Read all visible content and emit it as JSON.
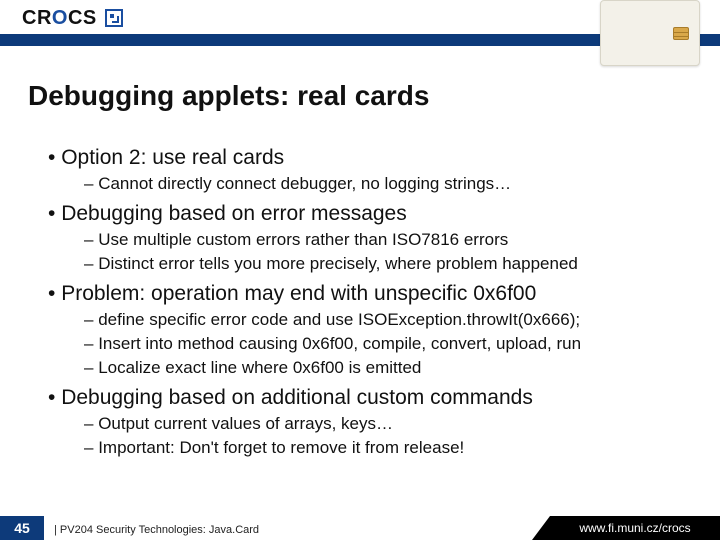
{
  "logo": {
    "text_pre": "CR",
    "text_o": "O",
    "text_post": "CS"
  },
  "title": "Debugging applets: real cards",
  "bullets": [
    {
      "level": 1,
      "text": "Option 2: use real cards"
    },
    {
      "level": 2,
      "text": "Cannot directly connect debugger, no logging strings…"
    },
    {
      "level": 1,
      "text": "Debugging based on error messages"
    },
    {
      "level": 2,
      "text": "Use multiple custom errors rather than ISO7816 errors"
    },
    {
      "level": 2,
      "text": "Distinct error tells you more precisely, where problem happened"
    },
    {
      "level": 1,
      "text": "Problem: operation may end with unspecific 0x6f00"
    },
    {
      "level": 2,
      "text": "define specific error code and use ISOException.throwIt(0x666);"
    },
    {
      "level": 2,
      "text": "Insert into method causing 0x6f00, compile, convert, upload, run"
    },
    {
      "level": 2,
      "text": "Localize exact line where 0x6f00 is emitted"
    },
    {
      "level": 1,
      "text": "Debugging based on additional custom commands"
    },
    {
      "level": 2,
      "text": "Output current values of arrays, keys…"
    },
    {
      "level": 2,
      "text": "Important: Don't forget to remove it from release!"
    }
  ],
  "footer": {
    "page": "45",
    "course": "| PV204 Security Technologies: Java.Card",
    "site": "www.fi.muni.cz/crocs"
  }
}
